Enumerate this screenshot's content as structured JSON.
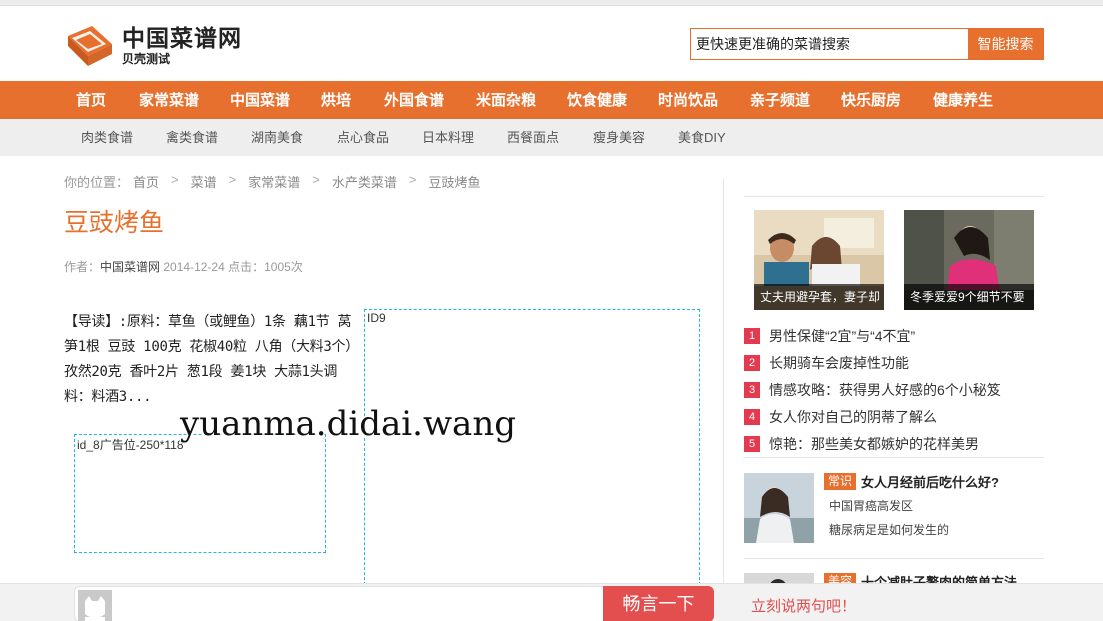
{
  "header": {
    "logo_title": "中国菜谱网",
    "logo_sub": "贝壳测试",
    "search_value": "更快速更准确的菜谱搜索",
    "search_button": "智能搜索"
  },
  "main_nav": [
    "首页",
    "家常菜谱",
    "中国菜谱",
    "烘培",
    "外国食谱",
    "米面杂粮",
    "饮食健康",
    "时尚饮品",
    "亲子频道",
    "快乐厨房",
    "健康养生"
  ],
  "sub_nav": [
    "肉类食谱",
    "禽类食谱",
    "湖南美食",
    "点心食品",
    "日本料理",
    "西餐面点",
    "瘦身美容",
    "美食DIY"
  ],
  "breadcrumb": {
    "prefix": "你的位置：",
    "items": [
      "首页",
      "菜谱",
      "家常菜谱",
      "水产类菜谱",
      "豆豉烤鱼"
    ]
  },
  "article": {
    "title": "豆豉烤鱼",
    "author_label": "作者：",
    "author": "中国菜谱网",
    "date": "2014-12-24",
    "clicks_label": "点击：",
    "clicks": "1005次",
    "intro": "【导读】:原料：草鱼（或鲤鱼）1条 藕1节 莴笋1根 豆豉 100克 花椒40粒 八角（大料3个）孜然20克 香叶2片 葱1段 姜1块 大蒜1头调料：料酒3..."
  },
  "ads": {
    "left": "id_8广告位-250*118",
    "right": "ID9"
  },
  "watermark": "yuanma.didai.wang",
  "sidebar": {
    "featured": [
      {
        "caption": "丈夫用避孕套，妻子却"
      },
      {
        "caption": "冬季爱爱9个细节不要"
      }
    ],
    "ranking": [
      {
        "num": "1",
        "text": "男性保健“2宜”与“4不宜”"
      },
      {
        "num": "2",
        "text": "长期骑车会废掉性功能"
      },
      {
        "num": "3",
        "text": "情感攻略：获得男人好感的6个小秘笈"
      },
      {
        "num": "4",
        "text": "女人你对自己的阴蒂了解么"
      },
      {
        "num": "5",
        "text": "惊艳：那些美女都嫉妒的花样美男"
      }
    ],
    "cards": [
      {
        "tag": "常识",
        "title": "女人月经前后吃什么好?",
        "links": [
          "中国胃癌高发区",
          "糖尿病足是如何发生的"
        ]
      },
      {
        "tag": "美容",
        "title": "十个减肚子赘肉的简单方法",
        "links": []
      }
    ]
  },
  "comment": {
    "button": "畅言一下",
    "prompt": "立刻说两句吧！"
  },
  "colors": {
    "brand": "#e8702e",
    "rank": "#e33a4f",
    "comment_red": "#e34e4e",
    "ad_border": "#26b6dd"
  }
}
